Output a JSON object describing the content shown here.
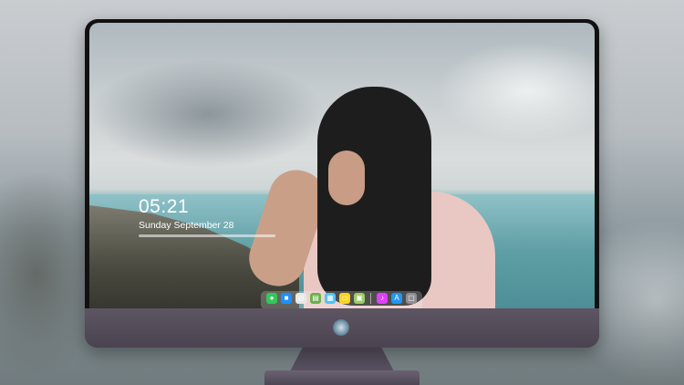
{
  "lock_screen": {
    "time": "05:21",
    "date": "Sunday September  28"
  },
  "dock": {
    "apps": [
      {
        "name": "messages-icon",
        "color": "#34c759",
        "glyph": "●"
      },
      {
        "name": "finder-icon",
        "color": "#1e90ff",
        "glyph": "■"
      },
      {
        "name": "safari-icon",
        "color": "#e8e8e8",
        "glyph": "◎"
      },
      {
        "name": "files-icon",
        "color": "#6ab04c",
        "glyph": "▤"
      },
      {
        "name": "photos-icon",
        "color": "#4fc3f7",
        "glyph": "▦"
      },
      {
        "name": "notes-icon",
        "color": "#f9d423",
        "glyph": "▭"
      },
      {
        "name": "preview-icon",
        "color": "#9ccc65",
        "glyph": "▣"
      },
      {
        "name": "music-icon",
        "color": "#e040fb",
        "glyph": "♪"
      },
      {
        "name": "app-store-icon",
        "color": "#2196f3",
        "glyph": "A"
      },
      {
        "name": "screenshot-icon",
        "color": "#8e8e93",
        "glyph": "▢"
      }
    ]
  }
}
